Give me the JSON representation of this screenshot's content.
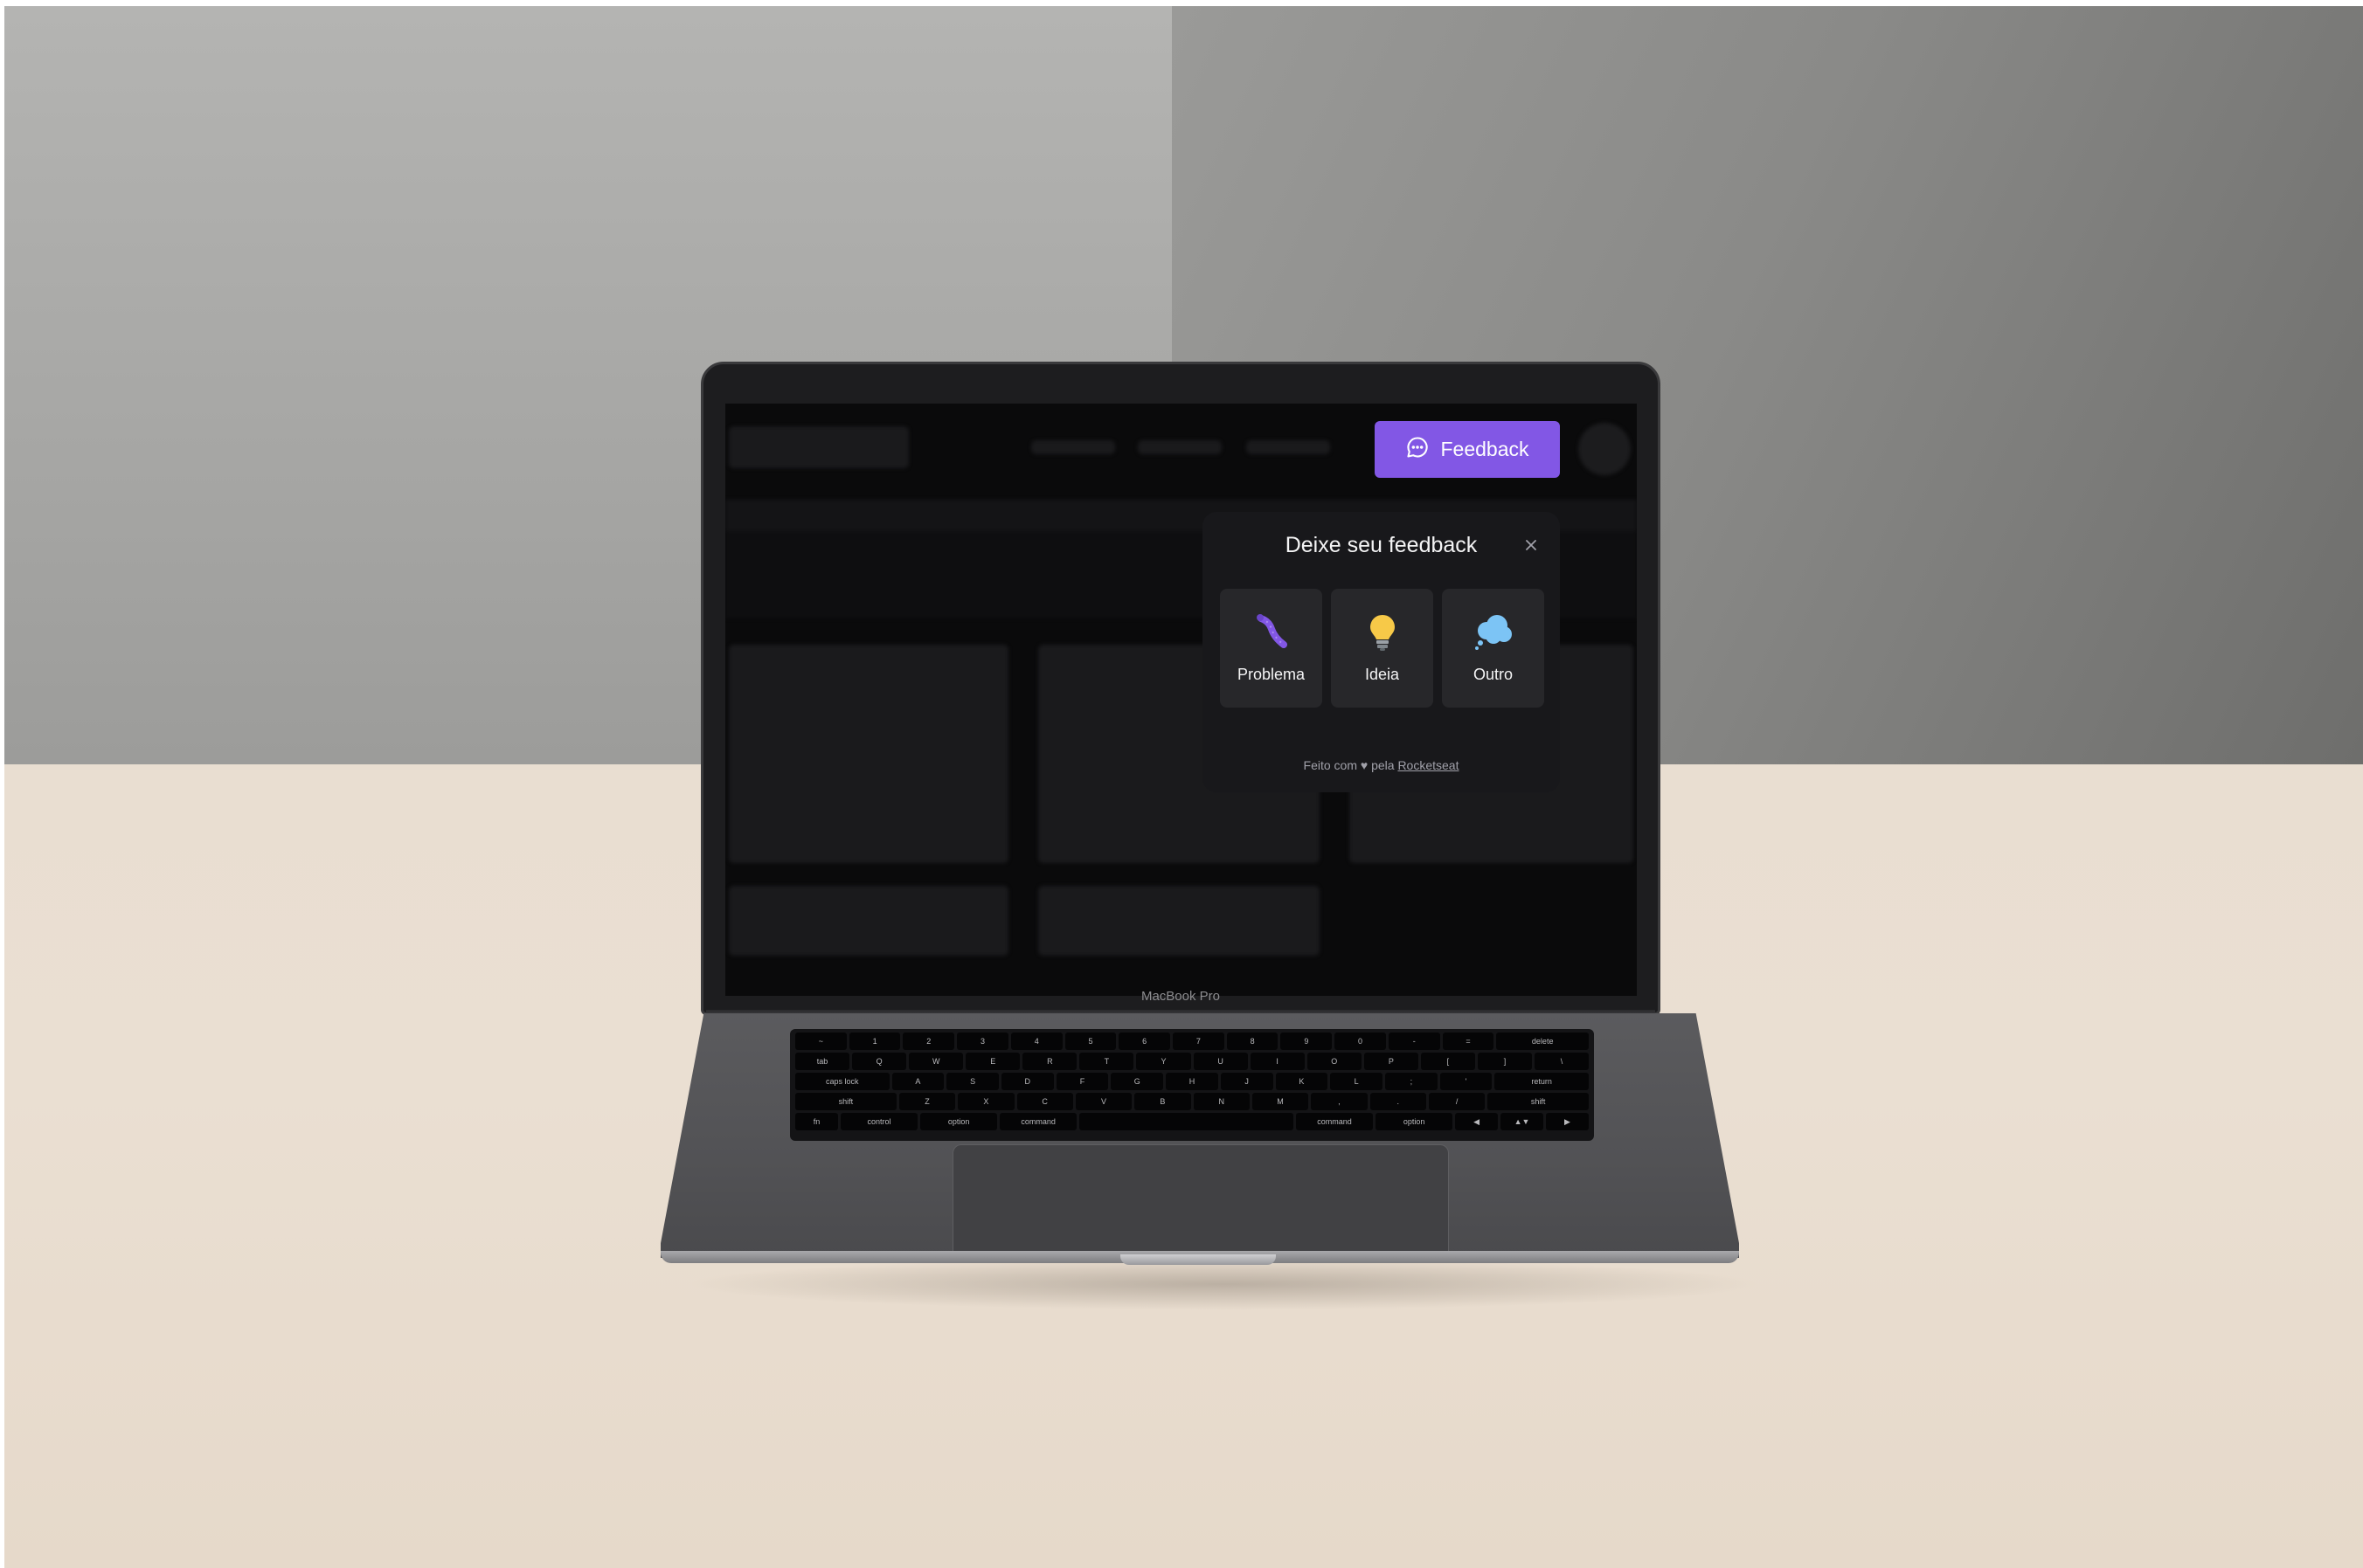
{
  "laptop": {
    "model_label": "MacBook Pro"
  },
  "widget": {
    "button_label": "Feedback",
    "popover_title": "Deixe seu feedback",
    "close_icon": "close-icon",
    "options": [
      {
        "label": "Problema",
        "icon": "bug-icon",
        "color": "#8257e5"
      },
      {
        "label": "Ideia",
        "icon": "lightbulb-icon",
        "color": "#f7c948"
      },
      {
        "label": "Outro",
        "icon": "thought-cloud-icon",
        "color": "#7cc4f5"
      }
    ],
    "footer": {
      "prefix": "Feito com",
      "heart_icon": "heart-icon",
      "middle": "pela",
      "link": "Rocketseat"
    }
  },
  "keyboard": {
    "rows": [
      [
        "~",
        "1",
        "2",
        "3",
        "4",
        "5",
        "6",
        "7",
        "8",
        "9",
        "0",
        "-",
        "=",
        "delete"
      ],
      [
        "tab",
        "Q",
        "W",
        "E",
        "R",
        "T",
        "Y",
        "U",
        "I",
        "O",
        "P",
        "[",
        "]",
        "\\"
      ],
      [
        "caps lock",
        "A",
        "S",
        "D",
        "F",
        "G",
        "H",
        "J",
        "K",
        "L",
        ";",
        "'",
        "return"
      ],
      [
        "shift",
        "Z",
        "X",
        "C",
        "V",
        "B",
        "N",
        "M",
        ",",
        ".",
        "/",
        "shift"
      ],
      [
        "fn",
        "control",
        "option",
        "command",
        "",
        "command",
        "option",
        "◀",
        "▲▼",
        "▶"
      ]
    ]
  },
  "colors": {
    "accent": "#8257e5",
    "surface": "#18181b",
    "option_bg": "#27272a"
  }
}
